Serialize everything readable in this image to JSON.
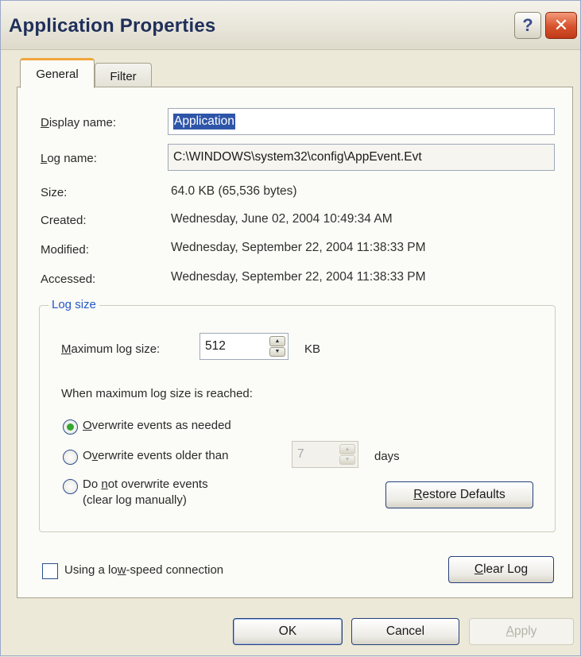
{
  "window": {
    "title": "Application Properties"
  },
  "titlebar": {
    "help_label": "?",
    "close_label": "✕"
  },
  "tabs": [
    {
      "label": "General",
      "active": true
    },
    {
      "label": "Filter",
      "active": false
    }
  ],
  "general": {
    "display_name": {
      "label": "Display name:",
      "value": "Application"
    },
    "log_name": {
      "label": "Log name:",
      "value": "C:\\WINDOWS\\system32\\config\\AppEvent.Evt"
    },
    "size": {
      "label": "Size:",
      "value": "64.0 KB (65,536 bytes)"
    },
    "created": {
      "label": "Created:",
      "value": "Wednesday, June 02, 2004 10:49:34 AM"
    },
    "modified": {
      "label": "Modified:",
      "value": "Wednesday, September 22, 2004 11:38:33 PM"
    },
    "accessed": {
      "label": "Accessed:",
      "value": "Wednesday, September 22, 2004 11:38:33 PM"
    }
  },
  "log_size": {
    "group_title": "Log size",
    "max_label": "Maximum log size:",
    "max_value": "512",
    "unit": "KB",
    "when_label": "When maximum log size is reached:",
    "options": [
      {
        "label": "Overwrite events as needed",
        "checked": true
      },
      {
        "label": "Overwrite events older than",
        "checked": false
      },
      {
        "label_line1": "Do not overwrite events",
        "label_line2": "(clear log manually)",
        "checked": false
      }
    ],
    "days_value": "7",
    "days_label": "days",
    "restore_button": "Restore Defaults"
  },
  "low_speed": {
    "label": "Using a low-speed connection",
    "checked": false
  },
  "clear_log_button": "Clear Log",
  "footer": {
    "ok": "OK",
    "cancel": "Cancel",
    "apply": "Apply"
  },
  "colors": {
    "title": "#1f2f5a",
    "selection": "#2e55a8",
    "group_title": "#2458c6",
    "close": "#d6522c",
    "radio_dot": "#35a633"
  }
}
